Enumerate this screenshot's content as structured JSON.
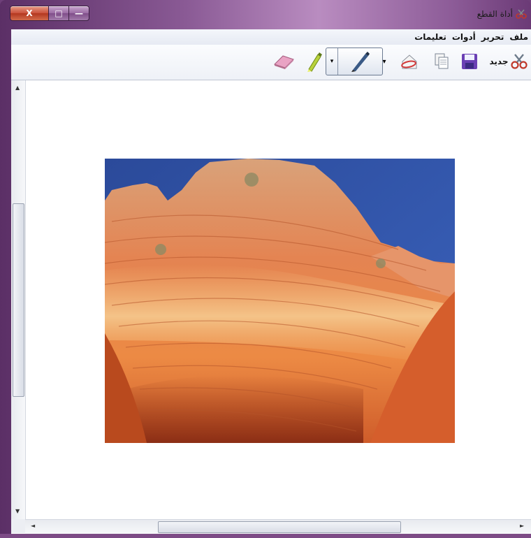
{
  "window": {
    "title": "أداة القطع",
    "caption_buttons": [
      "X",
      "□",
      "—"
    ]
  },
  "menu": {
    "items": [
      "ملف",
      "تحرير",
      "أدوات",
      "تعليمات"
    ]
  },
  "toolbar": {
    "new_label": "جديد",
    "dropdown_glyph": "▾"
  },
  "scroll": {
    "up_arrow": "▲",
    "down_arrow": "▼",
    "left_arrow": "◄",
    "right_arrow": "►"
  },
  "icons": {
    "app": "scissors-icon",
    "new": "scissors-icon",
    "save": "save-icon",
    "copy": "copy-icon",
    "send": "send-email-icon",
    "pen": "pen-icon",
    "highlighter": "highlighter-icon",
    "eraser": "eraser-icon"
  },
  "colors": {
    "frame": "#8a5a95",
    "sky": "#2f4fa2",
    "rock": "#e4763b"
  }
}
